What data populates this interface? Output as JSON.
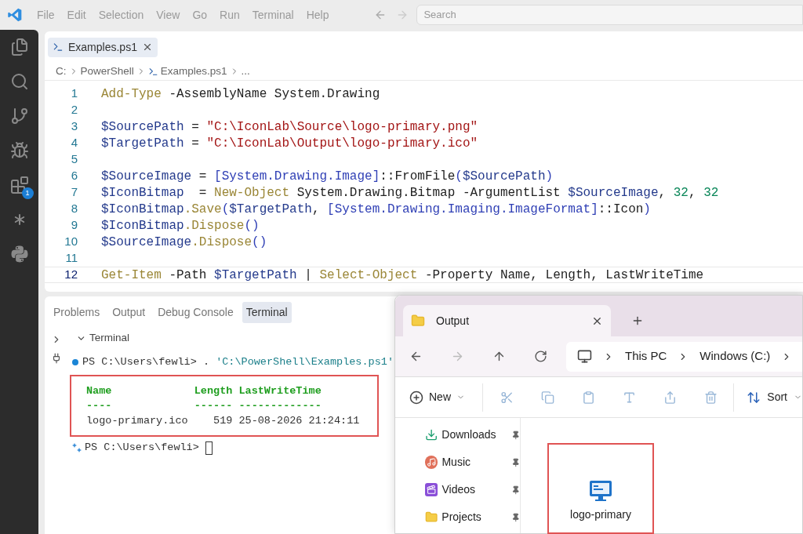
{
  "menu": [
    "File",
    "Edit",
    "Selection",
    "View",
    "Go",
    "Run",
    "Terminal",
    "Help"
  ],
  "search": {
    "placeholder": "Search"
  },
  "activity_bar": [
    {
      "kind": "files"
    },
    {
      "kind": "search"
    },
    {
      "kind": "source-control"
    },
    {
      "kind": "run-debug"
    },
    {
      "kind": "extensions",
      "badge": "1"
    },
    {
      "kind": "asterisk"
    },
    {
      "kind": "python"
    }
  ],
  "editor_tab": {
    "label": "Examples.ps1"
  },
  "breadcrumbs": [
    {
      "label": "C:",
      "kind": "text"
    },
    {
      "label": "PowerShell",
      "kind": "text"
    },
    {
      "label": "Examples.ps1",
      "kind": "file"
    },
    {
      "label": "...",
      "kind": "text"
    }
  ],
  "code_lines": [
    {
      "number": "1",
      "current": false,
      "tokens": [
        {
          "kind": "cmd",
          "text": "Add-Type"
        },
        {
          "kind": "plain",
          "text": " -AssemblyName System.Drawing"
        }
      ]
    },
    {
      "number": "2",
      "current": false
    },
    {
      "number": "3",
      "current": false,
      "tokens": [
        {
          "kind": "var",
          "text": "$SourcePath"
        },
        {
          "kind": "plain",
          "text": " = "
        },
        {
          "kind": "str",
          "text": "\"C:\\IconLab\\Source\\logo-primary.png\""
        }
      ]
    },
    {
      "number": "4",
      "current": false,
      "tokens": [
        {
          "kind": "var",
          "text": "$TargetPath"
        },
        {
          "kind": "plain",
          "text": " = "
        },
        {
          "kind": "str",
          "text": "\"C:\\IconLab\\Output\\logo-primary.ico\""
        }
      ]
    },
    {
      "number": "5",
      "current": false
    },
    {
      "number": "6",
      "current": false,
      "tokens": [
        {
          "kind": "var",
          "text": "$SourceImage"
        },
        {
          "kind": "plain",
          "text": " = "
        },
        {
          "kind": "type",
          "text": "[System.Drawing.Image]"
        },
        {
          "kind": "plain",
          "text": "::FromFile"
        },
        {
          "kind": "type",
          "text": "("
        },
        {
          "kind": "var",
          "text": "$SourcePath"
        },
        {
          "kind": "type",
          "text": ")"
        }
      ]
    },
    {
      "number": "7",
      "current": false,
      "tokens": [
        {
          "kind": "var",
          "text": "$IconBitmap"
        },
        {
          "kind": "plain",
          "text": "  = "
        },
        {
          "kind": "cmd",
          "text": "New-Object"
        },
        {
          "kind": "plain",
          "text": " System.Drawing.Bitmap -ArgumentList "
        },
        {
          "kind": "var",
          "text": "$SourceImage"
        },
        {
          "kind": "plain",
          "text": ", "
        },
        {
          "kind": "num",
          "text": "32"
        },
        {
          "kind": "plain",
          "text": ", "
        },
        {
          "kind": "num",
          "text": "32"
        }
      ]
    },
    {
      "number": "8",
      "current": false,
      "tokens": [
        {
          "kind": "var",
          "text": "$IconBitmap"
        },
        {
          "kind": "cmd",
          "text": ".Save"
        },
        {
          "kind": "type",
          "text": "("
        },
        {
          "kind": "var",
          "text": "$TargetPath"
        },
        {
          "kind": "plain",
          "text": ", "
        },
        {
          "kind": "type",
          "text": "[System.Drawing.Imaging.ImageFormat]"
        },
        {
          "kind": "plain",
          "text": "::Icon"
        },
        {
          "kind": "type",
          "text": ")"
        }
      ]
    },
    {
      "number": "9",
      "current": false,
      "tokens": [
        {
          "kind": "var",
          "text": "$IconBitmap"
        },
        {
          "kind": "cmd",
          "text": ".Dispose"
        },
        {
          "kind": "type",
          "text": "()"
        }
      ]
    },
    {
      "number": "10",
      "current": false,
      "tokens": [
        {
          "kind": "var",
          "text": "$SourceImage"
        },
        {
          "kind": "cmd",
          "text": ".Dispose"
        },
        {
          "kind": "type",
          "text": "()"
        }
      ]
    },
    {
      "number": "11",
      "current": false
    },
    {
      "number": "12",
      "current": true,
      "tokens": [
        {
          "kind": "cmd",
          "text": "Get-Item"
        },
        {
          "kind": "plain",
          "text": " -Path "
        },
        {
          "kind": "var",
          "text": "$TargetPath"
        },
        {
          "kind": "plain",
          "text": " | "
        },
        {
          "kind": "cmd",
          "text": "Select-Object"
        },
        {
          "kind": "plain",
          "text": " -Property Name, Length, LastWriteTime"
        }
      ]
    }
  ],
  "panel_tabs": [
    {
      "label": "Problems",
      "selected": false
    },
    {
      "label": "Output",
      "selected": false
    },
    {
      "label": "Debug Console",
      "selected": false
    },
    {
      "label": "Terminal",
      "selected": true
    }
  ],
  "terminal": {
    "title": "Terminal",
    "command": {
      "prompt": "PS C:\\Users\\fewli> . ",
      "argument": "'C:\\PowerShell\\Examples.ps1'"
    },
    "table_header": "Name             Length LastWriteTime",
    "table_rule": "----             ------ -------------",
    "table_rows": [
      "logo-primary.ico    519 25-08-2026 21:24:11"
    ],
    "prompt": "PS C:\\Users\\fewli>"
  },
  "explorer": {
    "tab": "Output",
    "path": [
      "This PC",
      "Windows (C:)"
    ],
    "new_label": "New",
    "sort_label": "Sort",
    "nav_items": [
      {
        "kind": "download",
        "label": "Downloads"
      },
      {
        "kind": "music",
        "label": "Music"
      },
      {
        "kind": "video",
        "label": "Videos"
      },
      {
        "kind": "folder",
        "label": "Projects"
      }
    ],
    "files": [
      {
        "name": "logo-primary"
      }
    ]
  }
}
